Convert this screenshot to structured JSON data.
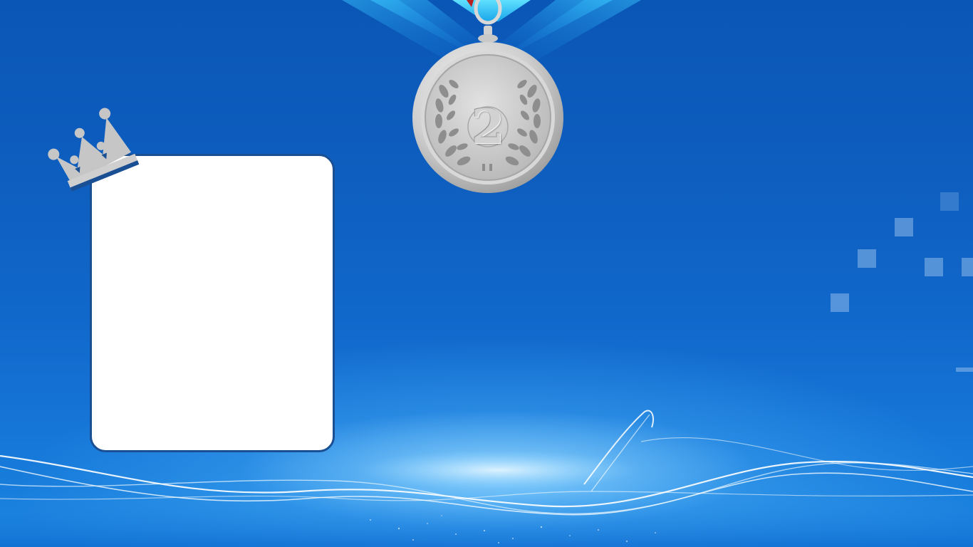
{
  "medal": {
    "rank": "2",
    "icon": "silver-medal-icon"
  },
  "crown": {
    "icon": "crown-icon"
  },
  "photo_frame": {
    "content": ""
  },
  "colors": {
    "background_top": "#0a56b6",
    "background_bottom": "#1a84e0",
    "frame_border": "#1a4f93",
    "silver": "#c8c8c8",
    "ribbon": "#1ec8f0"
  }
}
